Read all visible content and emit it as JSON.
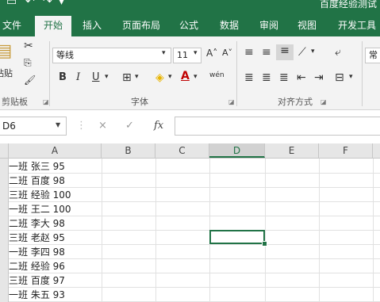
{
  "title": "百度经验测试",
  "ribbon_tabs": [
    "文件",
    "开始",
    "插入",
    "页面布局",
    "公式",
    "数据",
    "审阅",
    "视图",
    "开发工具"
  ],
  "ribbon": {
    "clipboard": {
      "paste_label": "粘贴",
      "group_label": "剪贴板"
    },
    "font": {
      "name": "等线",
      "size": "11",
      "group_label": "字体",
      "bold": "B",
      "italic": "I",
      "underline": "U",
      "grow": "A˄",
      "shrink": "A˅",
      "phonetic": "wén"
    },
    "alignment": {
      "group_label": "对齐方式"
    },
    "number": {
      "partial_label": "常"
    }
  },
  "formula_bar": {
    "name_box": "D6",
    "fx": "fx",
    "cancel": "×",
    "enter": "✓",
    "formula": ""
  },
  "columns": [
    "A",
    "B",
    "C",
    "D",
    "E",
    "F"
  ],
  "selected_column": "D",
  "cells_a": [
    "一班 张三 95",
    "二班 百度 98",
    "三班 经验 100",
    "一班 王二 100",
    "二班 李大 98",
    "三班 老赵 95",
    "一班 李四 98",
    "二班 经验 96",
    "三班 百度 97",
    "一班 朱五 93"
  ],
  "colors": {
    "accent": "#217346"
  }
}
